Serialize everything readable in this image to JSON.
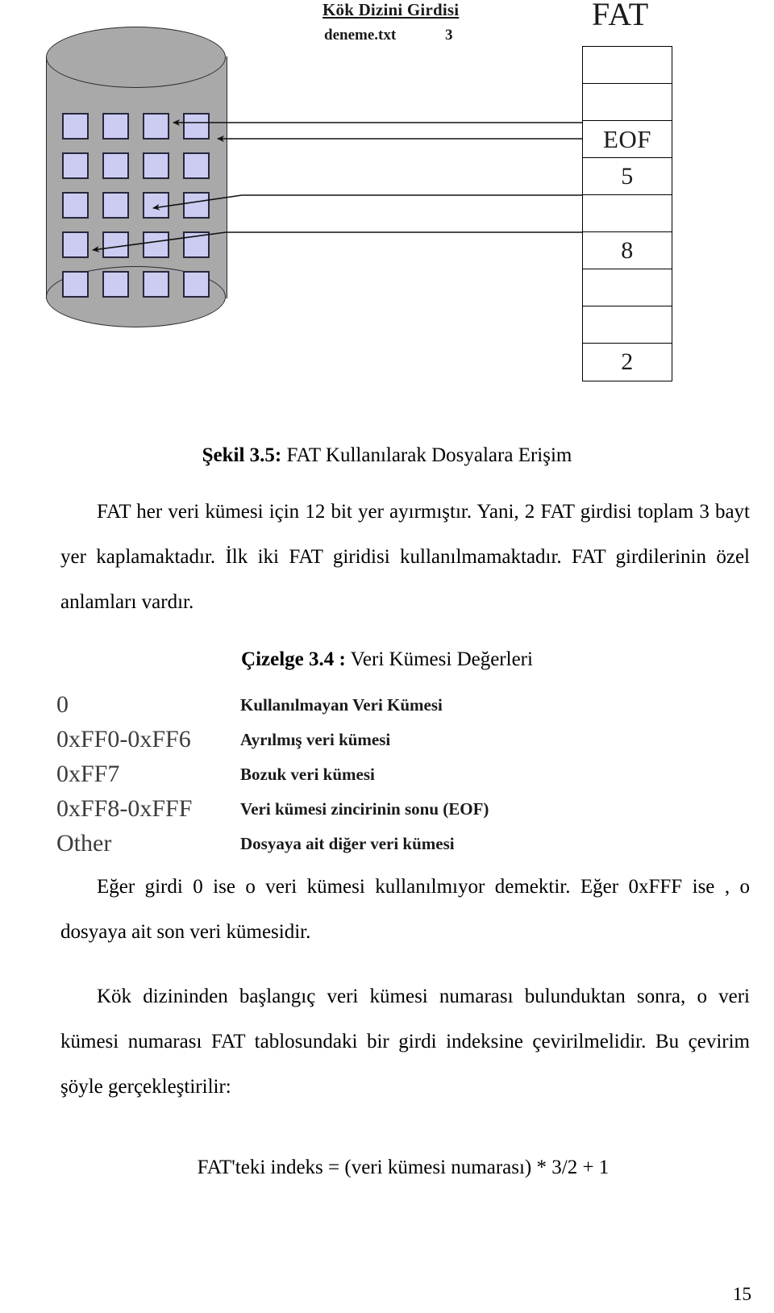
{
  "figure": {
    "root_dir_title": "Kök Dizini Girdisi",
    "root_dir_filename": "deneme.txt",
    "root_dir_cluster": "3",
    "fat_title": "FAT",
    "fat_entries": [
      "",
      "",
      "EOF",
      "5",
      "",
      "8",
      "",
      "",
      "2"
    ],
    "cluster_count": 20,
    "colors": {
      "cylinder": "#a9a9a9",
      "cluster": "#ccccf2",
      "outline": "#000000"
    }
  },
  "figure_caption": {
    "label": "Şekil 3.5:",
    "text": " FAT Kullanılarak Dosyalara Erişim"
  },
  "paragraphs": {
    "p1": "FAT her veri kümesi için 12 bit yer ayırmıştır. Yani, 2 FAT girdisi toplam 3 bayt yer kaplamaktadır. İlk iki FAT giridisi kullanılmamaktadır. FAT girdilerinin özel anlamları vardır.",
    "p2": "Eğer girdi 0 ise o veri kümesi kullanılmıyor demektir. Eğer 0xFFF ise , o dosyaya ait son veri kümesidir.",
    "p3": "Kök dizininden başlangıç veri kümesi numarası bulunduktan sonra, o veri kümesi numarası FAT tablosundaki bir girdi indeksine çevirilmelidir. Bu çevirim şöyle gerçekleştirilir:"
  },
  "table_caption": {
    "label": "Çizelge 3.4 :",
    "text": " Veri Kümesi Değerleri"
  },
  "value_table": {
    "rows": [
      {
        "code": "0",
        "desc": "Kullanılmayan Veri Kümesi"
      },
      {
        "code": "0xFF0-0xFF6",
        "desc": "Ayrılmış veri kümesi"
      },
      {
        "code": "0xFF7",
        "desc": "Bozuk veri kümesi"
      },
      {
        "code": "0xFF8-0xFFF",
        "desc": "Veri kümesi zincirinin sonu (EOF)"
      },
      {
        "code": "Other",
        "desc": "Dosyaya ait diğer veri kümesi"
      }
    ]
  },
  "formula": "FAT'teki indeks = (veri kümesi numarası) * 3/2 + 1",
  "page_number": "15"
}
